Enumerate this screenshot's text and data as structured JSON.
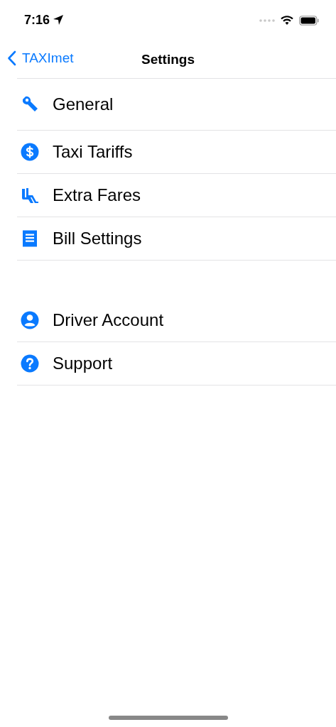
{
  "status_bar": {
    "time": "7:16"
  },
  "nav": {
    "back": "TAXImet",
    "title": "Settings"
  },
  "sections": [
    {
      "items": [
        {
          "label": "General"
        },
        {
          "label": "Taxi Tariffs"
        },
        {
          "label": "Extra Fares"
        },
        {
          "label": "Bill Settings"
        }
      ]
    },
    {
      "items": [
        {
          "label": "Driver Account"
        },
        {
          "label": "Support"
        }
      ]
    }
  ]
}
